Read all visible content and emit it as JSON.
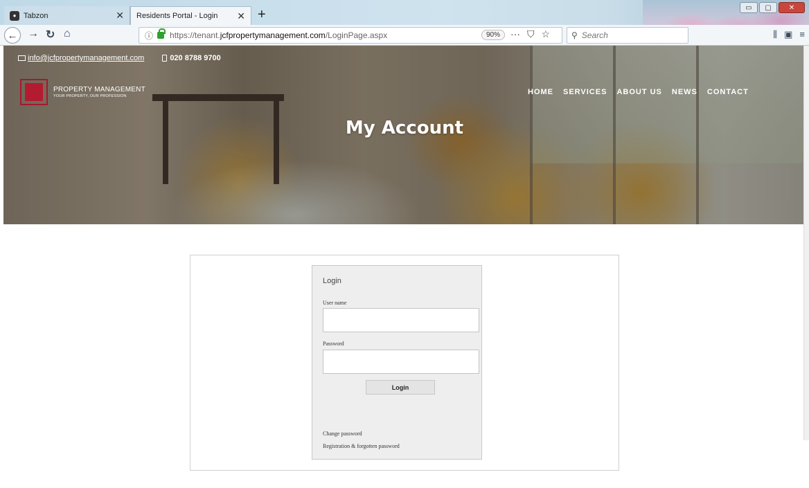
{
  "browser": {
    "tabs": [
      {
        "title": "Tabzon",
        "active": false
      },
      {
        "title": "Residents Portal - Login",
        "active": true
      }
    ],
    "url": {
      "prefix": "https://tenant.",
      "domain": "jcfpropertymanagement.com",
      "path": "/LoginPage.aspx"
    },
    "zoom": "90%",
    "search_placeholder": "Search"
  },
  "site": {
    "contact": {
      "email": "info@jcfpropertymanagement.com",
      "phone": "020 8788 9700"
    },
    "logo": {
      "name": "PROPERTY MANAGEMENT",
      "tagline": "YOUR PROPERTY, OUR PROFESSION"
    },
    "nav": [
      "HOME",
      "SERVICES",
      "ABOUT US",
      "NEWS",
      "CONTACT"
    ],
    "heading": "My Account",
    "brand_color": "#b31b31"
  },
  "login": {
    "title": "Login",
    "username_label": "User name",
    "username_value": "",
    "password_label": "Password",
    "password_value": "",
    "button_label": "Login",
    "links": [
      "Change password",
      "Registration & forgotten password"
    ]
  }
}
